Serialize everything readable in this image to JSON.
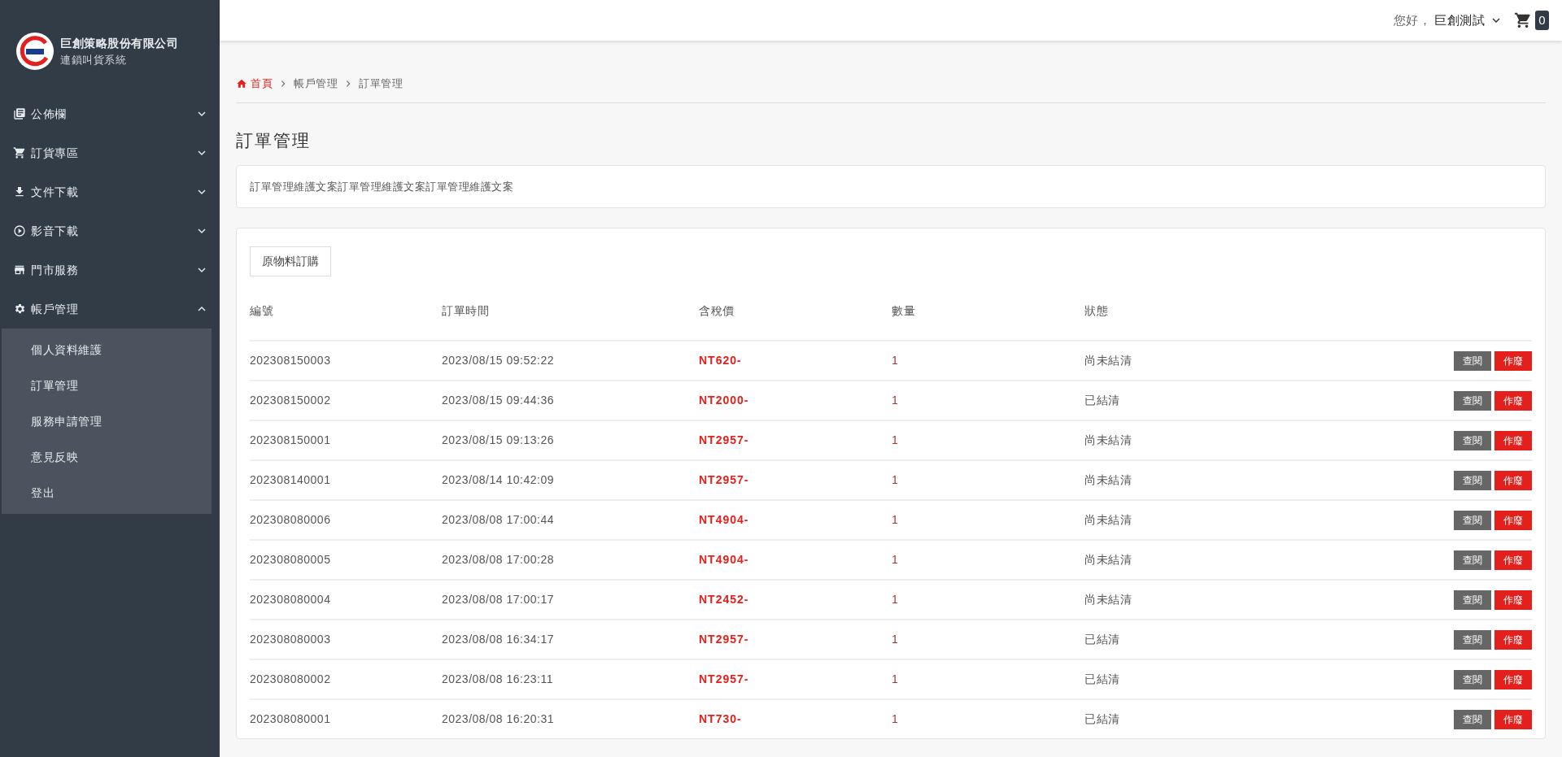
{
  "sidebar": {
    "company": "巨創策略股份有限公司",
    "subtitle": "連鎖叫貨系統",
    "items": [
      {
        "label": "公佈欄",
        "kind": "board",
        "expanded": false
      },
      {
        "label": "訂貨專區",
        "kind": "cart",
        "expanded": false
      },
      {
        "label": "文件下載",
        "kind": "download",
        "expanded": false
      },
      {
        "label": "影音下載",
        "kind": "play",
        "expanded": false
      },
      {
        "label": "門市服務",
        "kind": "store",
        "expanded": false
      },
      {
        "label": "帳戶管理",
        "kind": "gear",
        "expanded": true,
        "children": [
          {
            "label": "個人資料維護"
          },
          {
            "label": "訂單管理"
          },
          {
            "label": "服務申請管理"
          },
          {
            "label": "意見反映"
          },
          {
            "label": "登出"
          }
        ]
      }
    ]
  },
  "topbar": {
    "greeting": "您好，",
    "user": "巨創測試",
    "cart_count": "0"
  },
  "breadcrumb": [
    {
      "label": "首頁",
      "kind": "home"
    },
    {
      "label": "帳戶管理",
      "kind": "link"
    },
    {
      "label": "訂單管理",
      "kind": "current"
    }
  ],
  "page_title": "訂單管理",
  "description": "訂單管理維護文案訂單管理維護文案訂單管理維護文案",
  "order_button": "原物料訂購",
  "table": {
    "columns": [
      "編號",
      "訂單時間",
      "含稅價",
      "數量",
      "狀態"
    ],
    "rows": [
      {
        "id": "202308150003",
        "time": "2023/08/15 09:52:22",
        "price": "NT620-",
        "qty": "1",
        "status": "尚未結清",
        "actions": [
          "查閱",
          "作廢"
        ]
      },
      {
        "id": "202308150002",
        "time": "2023/08/15 09:44:36",
        "price": "NT2000-",
        "qty": "1",
        "status": "已結清",
        "actions": [
          "查閱",
          "作廢"
        ]
      },
      {
        "id": "202308150001",
        "time": "2023/08/15 09:13:26",
        "price": "NT2957-",
        "qty": "1",
        "status": "尚未結清",
        "actions": [
          "查閱",
          "作廢"
        ]
      },
      {
        "id": "202308140001",
        "time": "2023/08/14 10:42:09",
        "price": "NT2957-",
        "qty": "1",
        "status": "尚未結清",
        "actions": [
          "查閱",
          "作廢"
        ]
      },
      {
        "id": "202308080006",
        "time": "2023/08/08 17:00:44",
        "price": "NT4904-",
        "qty": "1",
        "status": "尚未結清",
        "actions": [
          "查閱",
          "作廢"
        ]
      },
      {
        "id": "202308080005",
        "time": "2023/08/08 17:00:28",
        "price": "NT4904-",
        "qty": "1",
        "status": "尚未結清",
        "actions": [
          "查閱",
          "作廢"
        ]
      },
      {
        "id": "202308080004",
        "time": "2023/08/08 17:00:17",
        "price": "NT2452-",
        "qty": "1",
        "status": "尚未結清",
        "actions": [
          "查閱",
          "作廢"
        ]
      },
      {
        "id": "202308080003",
        "time": "2023/08/08 16:34:17",
        "price": "NT2957-",
        "qty": "1",
        "status": "已結清",
        "actions": [
          "查閱",
          "作廢"
        ]
      },
      {
        "id": "202308080002",
        "time": "2023/08/08 16:23:11",
        "price": "NT2957-",
        "qty": "1",
        "status": "已結清",
        "actions": [
          "查閱",
          "作廢"
        ]
      },
      {
        "id": "202308080001",
        "time": "2023/08/08 16:20:31",
        "price": "NT730-",
        "qty": "1",
        "status": "已結清",
        "actions": [
          "查閱",
          "作廢"
        ]
      }
    ]
  }
}
